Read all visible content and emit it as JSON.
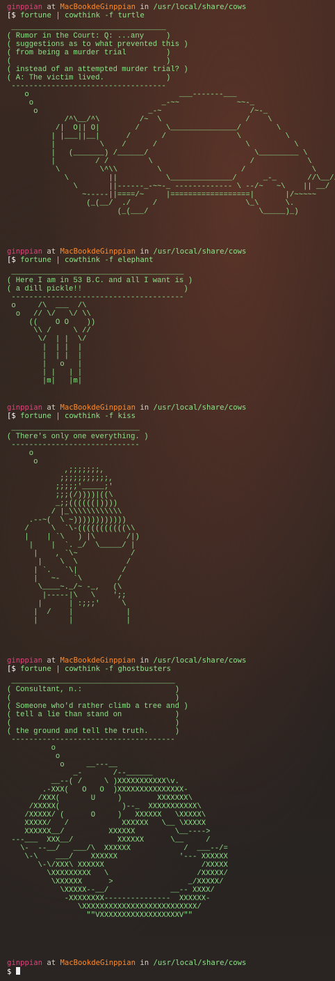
{
  "prompt": {
    "user": "ginppian",
    "at": " at ",
    "host": "MacBookdeGinppian",
    "in": " in ",
    "path": "/usr/local/share/cows",
    "symbol": "$"
  },
  "sessions": [
    {
      "command": "fortune | cowthink -f turtle",
      "output": " ___________________________________\n( Rumor in the Court: Q: ...any     )\n( suggestions as to what prevented this )\n( from being a murder trial         )\n(                                   )\n( instead of an attempted murder trial? )\n( A: The victim lived.              )\n -----------------------------------\n    o                                  ___-------___\n     o                             _-~~             ~~-_\n      o                         _-~                    /~-_\n             /^\\__/^\\         /~  \\                   /    \\\n           /|  O|| O|        /      \\_______________/        \\\n          | |___||__|      /       /                \\          \\\n          |          \\    /      /                    \\          \\\n          |   (_______) /______/                        \\_________ \\\n          |         / /         \\                      /            \\\n           \\         \\^\\\\         \\                  /               \\     /\n             \\         ||           \\______________/      _-_       //\\__//\n               \\       ||------_-~~-_ ------------- \\ --/~   ~\\    || __/\n                 ~-----||====/~     |==================|       |/~~~~~\n                  (_(__/  ./     /                    \\_\\      \\.\n                         (_(___/                         \\_____)_)"
    },
    {
      "command": "fortune | cowthink -f elephant",
      "output": " _______________________________________\n( Here I am in 53 B.C. and all I want is )\n( a dill pickle!!                       )\n ---------------------------------------\n o     /\\  ___  /\\\n  o   // \\/   \\/ \\\\\n     ((    O O    ))\n      \\\\ /     \\ //\n       \\/  | |  \\/\n        |  | |  |\n        |  | |  |\n        |   o   |\n        | |   | |\n        |m|   |m|"
    },
    {
      "command": "fortune | cowthink -f kiss",
      "output": " _____________________________\n( There's only one everything. )\n -----------------------------\n     o\n      o\n             ,;;;;;;;,\n            ;;;;;;;;;;;,\n           ;;;;;'_____;'\n           ;;;(/))))|((\\\n           _;;((((((|))))\n          / |_\\\\\\\\\\\\\\\\\\\\\\\\\n     .--~(  \\ ~))))))))))))\n    /     \\  `\\-(((((((((((\\\\\n    |    | `\\   ) |\\       /|)\n     |    |  `. _/  \\_____/ |\n      |    , `\\~            /\n       |    \\  \\           /\n      | `.   `\\|          /\n      |   ~-   `\\        /\n       \\____~._/~ -_,   (\\\n        |-----|\\   \\    ';;\n       |      | :;;;'     \\\n      |  /    |            |\n      |       |            |"
    },
    {
      "command": "fortune | cowthink -f ghostbusters",
      "output": " _____________________________________\n( Consultant, n.:                     )\n(                                     )\n( Someone who'd rather climb a tree and )\n( tell a lie than stand on            )\n(                                     )\n( the ground and tell the truth.      )\n -------------------------------------\n          o\n           o\n            o     __---__\n               _-       /--______\n          __--( /     \\ )XXXXXXXXXXX\\v.\n        .-XXX(   O   O  )XXXXXXXXXXXXXXX-\n       /XXX(       U     )        XXXXXXX\\\n     /XXXXX(              )--_  XXXXXXXXXXX\\\n    /XXXXX/ (      O     )   XXXXXX   \\XXXXX\\\n    XXXXX/   /            XXXXXX   \\__ \\XXXXX\n    XXXXXX__/          XXXXXX         \\__---->\n ---___  XXX__/          XXXXXX      \\__     /\n   \\-  --__/   ___/\\  XXXXXX            /  ___--/=\n    \\-\\    ___/    XXXXXX              '--- XXXXXX\n       \\-\\/XXX\\ XXXXXX                      /XXXXX\n         \\XXXXXXXXX   \\                    /XXXXX/\n          \\XXXXXX      >                 _/XXXXX/\n            \\XXXXX--__/              __-- XXXX/\n             -XXXXXXXX---------------  XXXXXX-\n                \\XXXXXXXXXXXXXXXXXXXXXXXXXX/\n                  \"\"VXXXXXXXXXXXXXXXXXXV\"\""
    }
  ],
  "final_prompt_symbol": "$"
}
